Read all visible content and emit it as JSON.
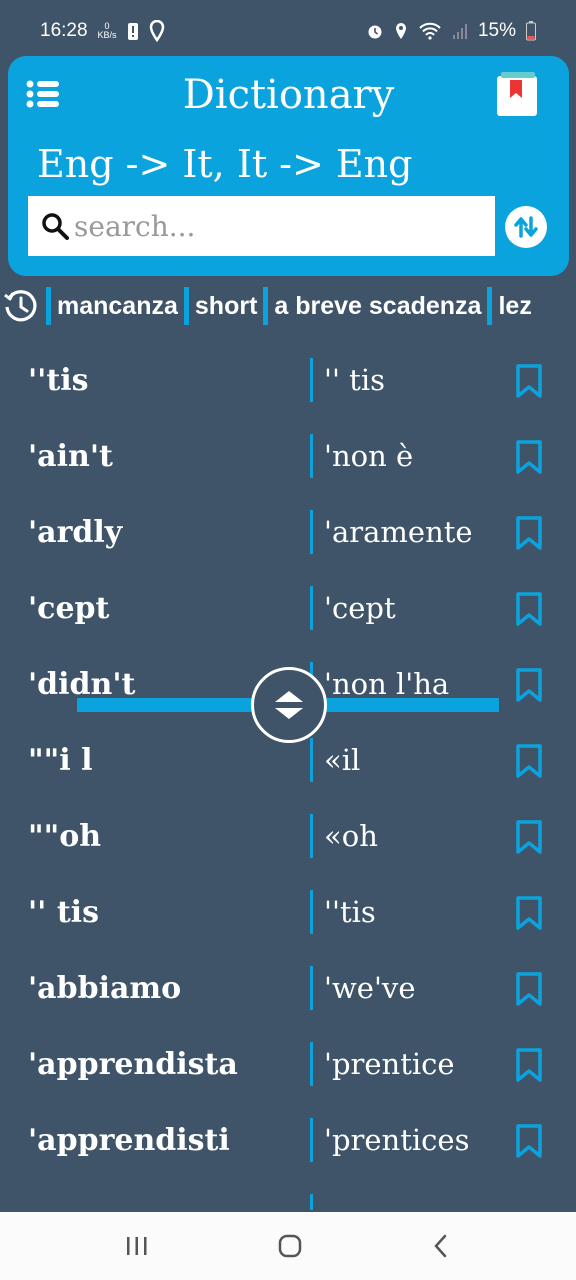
{
  "status": {
    "time": "16:28",
    "net_speed_value": "0",
    "net_speed_unit": "KB/s",
    "battery": "15%"
  },
  "header": {
    "title": "Dictionary",
    "subtitle": "Eng -> It,  It -> Eng",
    "search_placeholder": "search..."
  },
  "history": [
    "mancanza",
    "short",
    "a breve scadenza",
    "lez"
  ],
  "entries": [
    {
      "en": "''tis",
      "it": "'' tis"
    },
    {
      "en": "'ain't",
      "it": "'non è"
    },
    {
      "en": "'ardly",
      "it": "'aramente"
    },
    {
      "en": "'cept",
      "it": "'cept"
    },
    {
      "en": "'didn't",
      "it": "'non l'ha"
    },
    {
      "en": "\"\"i l",
      "it": "«il"
    },
    {
      "en": "\"\"oh",
      "it": "«oh"
    },
    {
      "en": "'' tis",
      "it": "''tis"
    },
    {
      "en": "'abbiamo",
      "it": "'we've"
    },
    {
      "en": "'apprendista",
      "it": "'prentice"
    },
    {
      "en": "'apprendisti",
      "it": "'prentices"
    }
  ],
  "colors": {
    "accent": "#0ba3de",
    "background": "#3f5468"
  },
  "icons": {
    "menu": "menu-icon",
    "bookmarks": "bookmark-book-icon",
    "search": "search-icon",
    "swap": "swap-languages-icon",
    "history": "history-icon",
    "entry_bookmark": "bookmark-icon",
    "divider": "resize-handle-icon"
  }
}
